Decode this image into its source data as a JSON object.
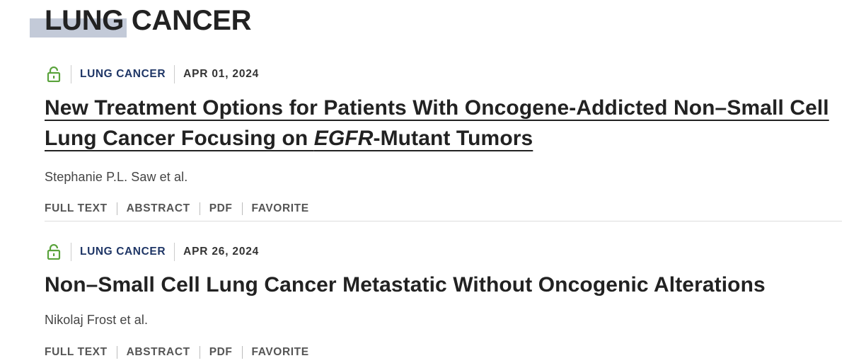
{
  "page": {
    "title": "LUNG CANCER"
  },
  "colors": {
    "title_accent": "#c3cad8",
    "category_text": "#1f3666",
    "open_access_icon": "#5aa33c",
    "divider": "#dddddd"
  },
  "icons": {
    "access": "open-lock-icon"
  },
  "articles": [
    {
      "category": "LUNG CANCER",
      "date": "APR 01, 2024",
      "title_before": "New Treatment Options for Patients With Oncogene-Addicted Non–Small Cell Lung Cancer Focusing on ",
      "title_em": "EGFR",
      "title_after": "-Mutant Tumors",
      "authors": "Stephanie P.L. Saw et al.",
      "actions": [
        "FULL TEXT",
        "ABSTRACT",
        "PDF",
        "FAVORITE"
      ]
    },
    {
      "category": "LUNG CANCER",
      "date": "APR 26, 2024",
      "title": "Non–Small Cell Lung Cancer Metastatic Without Oncogenic Alterations",
      "authors": "Nikolaj Frost et al.",
      "actions": [
        "FULL TEXT",
        "ABSTRACT",
        "PDF",
        "FAVORITE"
      ]
    }
  ]
}
